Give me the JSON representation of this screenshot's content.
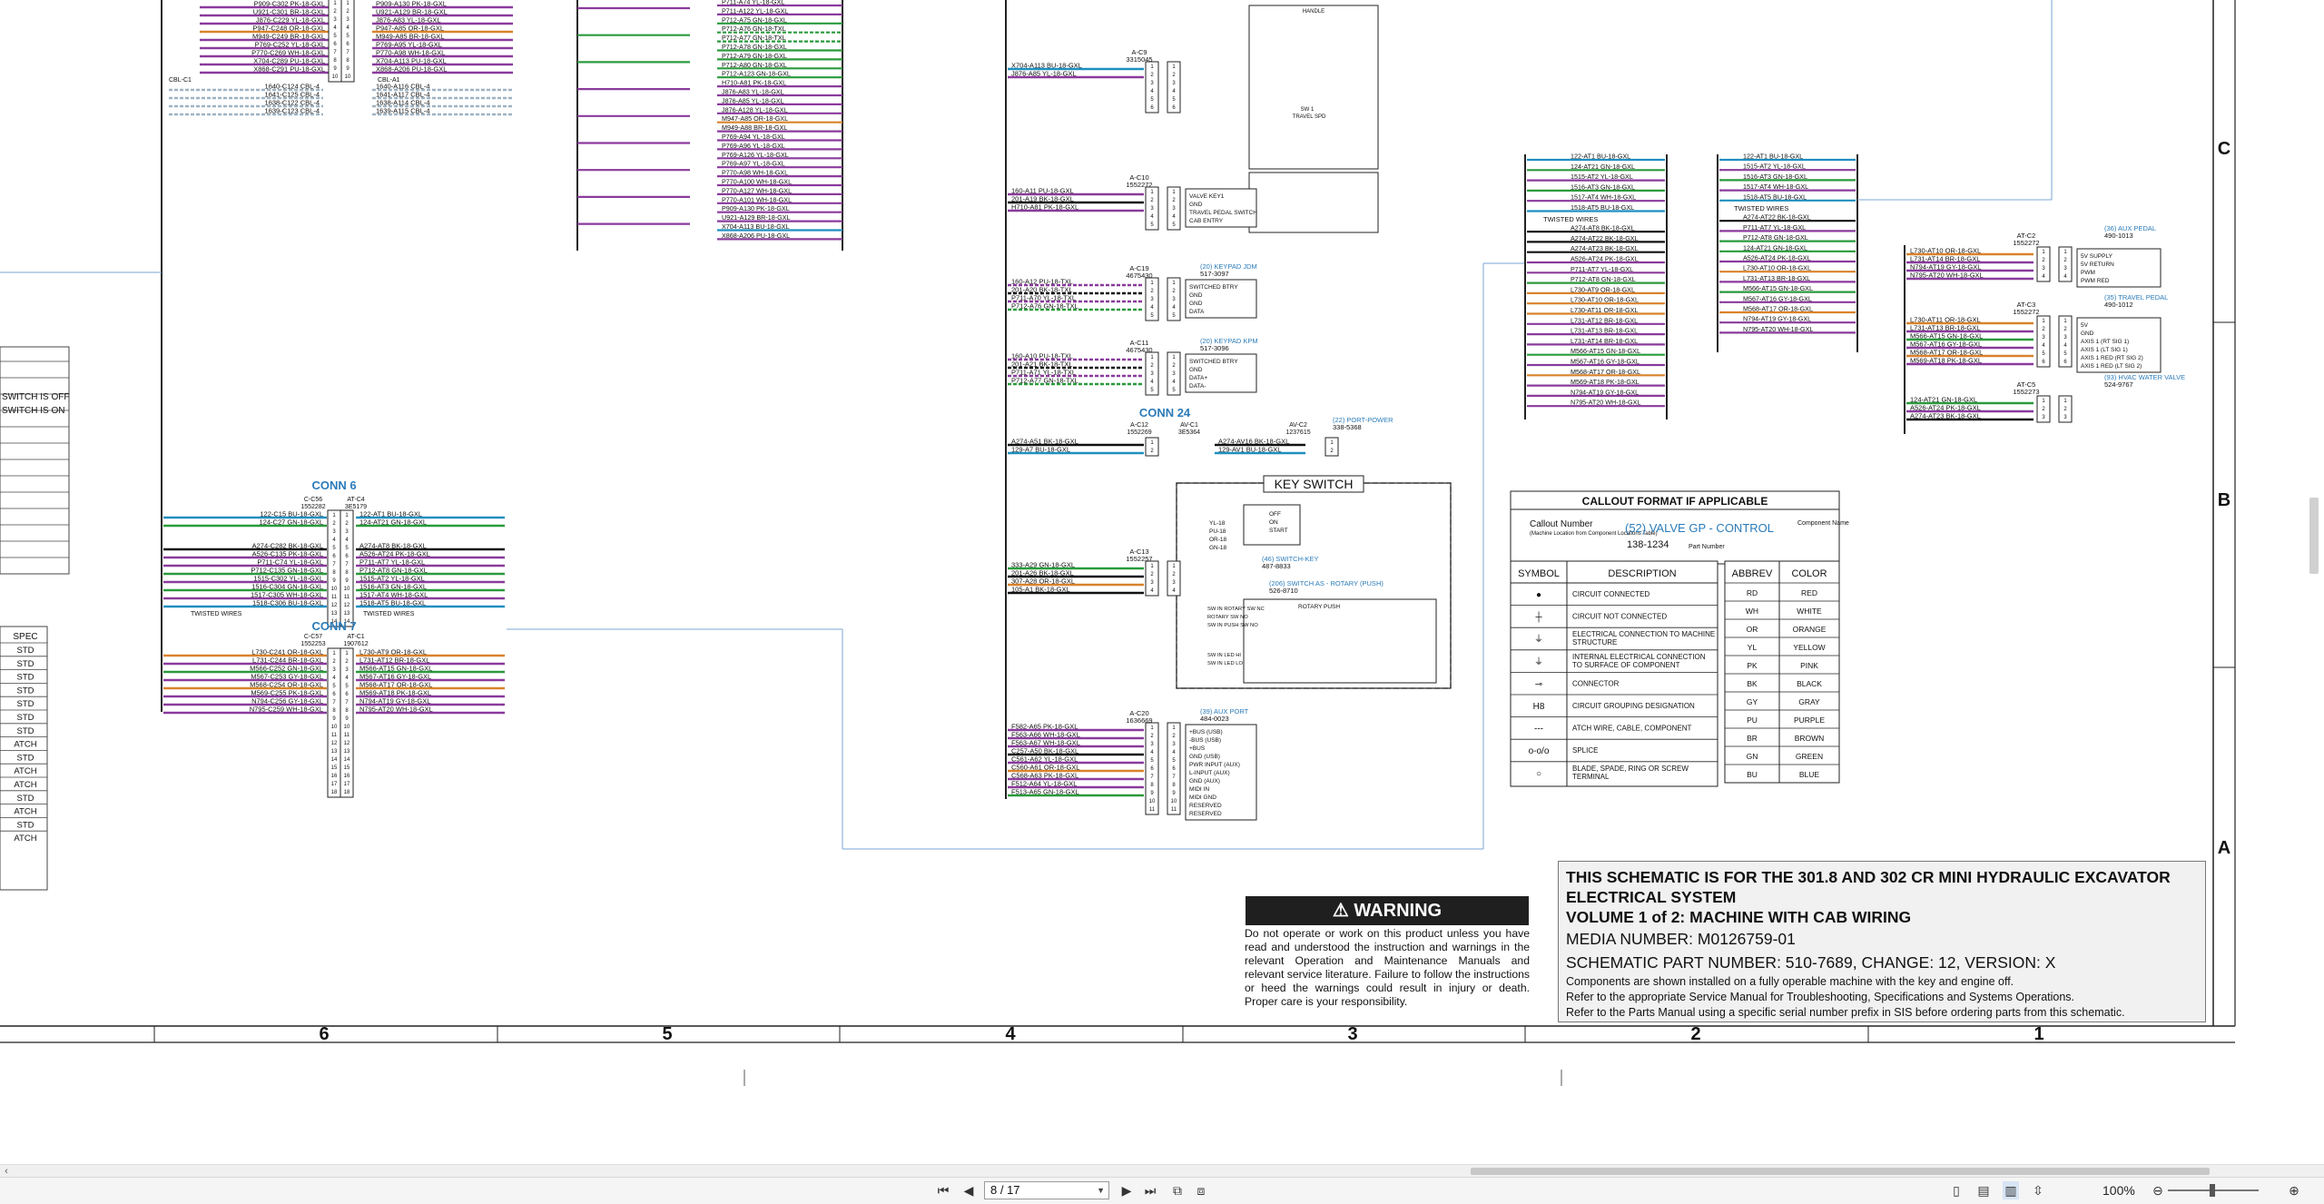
{
  "colors": {
    "purple": "#8a3a9c",
    "cyan": "#1f8fc0",
    "red": "#c8282b",
    "black": "#111111",
    "green": "#2a9a3c",
    "orange": "#d9822b",
    "link": "#2b7bb9",
    "route": "#7aa6d6",
    "gray_wire": "#9fb3c2"
  },
  "viewer": {
    "page_current": "8 / 17",
    "zoom": "100%",
    "icons": [
      "scroll-left-icon",
      "first-page-icon",
      "prev-page-icon",
      "next-page-icon",
      "last-page-icon",
      "page-view-icon",
      "page-tile-icon",
      "single-page-icon",
      "continuous-icon",
      "two-page-icon",
      "fit-icon",
      "zoom-out-icon",
      "zoom-in-icon"
    ]
  },
  "grid": {
    "columns": [
      "6",
      "5",
      "4",
      "3",
      "2",
      "1"
    ],
    "rows": [
      "C",
      "B",
      "A"
    ]
  },
  "side_table": {
    "notes": [
      "SWITCH IS OFF",
      "SWITCH IS ON"
    ],
    "spec_header": "SPEC",
    "spec_values": [
      "STD",
      "STD",
      "STD",
      "STD",
      "STD",
      "STD",
      "STD",
      "ATCH",
      "STD",
      "ATCH",
      "ATCH",
      "STD",
      "ATCH",
      "STD",
      "ATCH"
    ]
  },
  "top_left_wires": {
    "left": [
      "P909-C302 PK-18-GXL",
      "U921-C301 BR-18-GXL",
      "J876-C229 YL-18-GXL",
      "P947-C248 OR-18-GXL",
      "M949-C249 BR-18-GXL",
      "P769-C252 YL-18-GXL",
      "P770-C269 WH-18-GXL",
      "X704-C289 PU-18-GXL",
      "X868-C291 PU-18-GXL"
    ],
    "right": [
      "P909-A130 PK-18-GXL",
      "U921-A129 BR-18-GXL",
      "J876-A83 YL-18-GXL",
      "P947-A85 OR-18-GXL",
      "M949-A85 BR-18-GXL",
      "P769-A95 YL-18-GXL",
      "P770-A98 WH-18-GXL",
      "X704-A113 PU-18-GXL",
      "X868-A206 PU-18-GXL"
    ],
    "cbl_left_label": "CBL-C1",
    "cbl_right_label": "CBL-A1",
    "cbl_left": [
      "1640-C124 CBL-4",
      "1641-C125 CBL-4",
      "1638-C122 CBL-4",
      "1639-C123 CBL-4"
    ],
    "cbl_right": [
      "1640-A116 CBL-4",
      "1641-A117 CBL-4",
      "1638-A114 CBL-4",
      "1639-A115 CBL-4"
    ]
  },
  "conn6": {
    "title": "CONN 6",
    "left_head": "C-C56",
    "left_pn": "1552282",
    "right_head": "AT-C4",
    "right_pn": "3E5179",
    "left": [
      "122-C15 BU-18-GXL",
      "124-C27 GN-18-GXL",
      "A274-C282 BK-18-GXL",
      "A526-C135 PK-18-GXL",
      "P711-C74 YL-18-GXL",
      "P712-C135 GN-18-GXL",
      "1515-C302 YL-18-GXL",
      "1516-C304 GN-18-GXL",
      "1517-C305 WH-18-GXL",
      "1518-C306 BU-18-GXL"
    ],
    "right": [
      "122-AT1 BU-18-GXL",
      "124-AT21 GN-18-GXL",
      "A274-AT8 BK-18-GXL",
      "A526-AT24 PK-18-GXL",
      "P711-AT7 YL-18-GXL",
      "P712-AT8 GN-18-GXL",
      "1515-AT2 YL-18-GXL",
      "1516-AT3 GN-18-GXL",
      "1517-AT4 WH-18-GXL",
      "1518-AT5 BU-18-GXL"
    ],
    "twisted": "TWISTED WIRES"
  },
  "conn7": {
    "title": "CONN 7",
    "left_head": "C-C57",
    "left_pn": "1552253",
    "right_head": "AT-C1",
    "right_pn": "1907612",
    "left": [
      "L730-C241 OR-18-GXL",
      "L731-C244 BR-18-GXL",
      "M566-C252 GN-18-GXL",
      "M567-C253 GY-18-GXL",
      "M568-C254 OR-18-GXL",
      "M569-C255 PK-18-GXL",
      "N794-C256 GY-18-GXL",
      "N795-C259 WH-18-GXL"
    ],
    "right": [
      "L730-AT9 OR-18-GXL",
      "L731-AT12 BR-18-GXL",
      "M566-AT15 GN-18-GXL",
      "M567-AT16 GY-18-GXL",
      "M568-AT17 OR-18-GXL",
      "M569-AT18 PK-18-GXL",
      "N794-AT19 GY-18-GXL",
      "N795-AT20 WH-18-GXL"
    ]
  },
  "mid_wires": [
    "P711-A74 YL-18-GXL",
    "P711-A122 YL-18-GXL",
    "P712-A75 GN-18-GXL",
    "P712-A76 GN-18-TXL",
    "P712-A77 GN-18-TXL",
    "P712-A78 GN-18-GXL",
    "P712-A79 GN-18-GXL",
    "P712-A80 GN-18-GXL",
    "P712-A123 GN-18-GXL",
    "H710-A81 PK-18-GXL",
    "J876-A83 YL-18-GXL",
    "J876-A85 YL-18-GXL",
    "J876-A128 YL-18-GXL",
    "M947-A85 OR-18-GXL",
    "M949-A88 BR-18-GXL",
    "P769-A94 YL-18-GXL",
    "P769-A96 YL-18-GXL",
    "P769-A126 YL-18-GXL",
    "P769-A97 YL-18-GXL",
    "P770-A98 WH-18-GXL",
    "P770-A100 WH-18-GXL",
    "P770-A127 WH-18-GXL",
    "P770-A101 WH-18-GXL",
    "P909-A130 PK-18-GXL",
    "U921-A129 BR-18-GXL",
    "X704-A113 BU-18-GXL",
    "X868-A206 PU-18-GXL"
  ],
  "col4_connectors": {
    "c9": {
      "head": "A-C9",
      "pn": "3315045",
      "wires": [
        "X704-A113 BU-18-GXL",
        "J876-A85 YL-18-GXL"
      ]
    },
    "c10": {
      "head": "A-C10",
      "pn": "1552272",
      "wires": [
        "160-A11 PU-18-GXL",
        "201-A19 BK-18-GXL",
        "H710-A81 PK-18-GXL"
      ],
      "box": [
        "VALVE KEY1",
        "GND",
        "TRAVEL PEDAL SWITCH",
        "CAB ENTRY"
      ]
    },
    "c19": {
      "head": "A-C19",
      "pn": "4675430",
      "link": "(20) KEYPAD JDM",
      "link_pn": "517-3097",
      "wires": [
        "160-A12 PU-18-TXL",
        "201-A20 BK-18-TXL",
        "P711-A70 YL-18-TXL",
        "P712-A76 GN-18-TXL"
      ],
      "box": [
        "SWITCHED BTRY",
        "GND",
        "GND",
        "DATA"
      ]
    },
    "c11": {
      "head": "A-C11",
      "pn": "4675430",
      "link": "(20) KEYPAD KPM",
      "link_pn": "517-3096",
      "wires": [
        "160-A10 PU-18-TXL",
        "201-A21 BK-18-TXL",
        "P711-A71 YL-18-TXL",
        "P712-A77 GN-18-TXL"
      ],
      "box": [
        "SWITCHED BTRY",
        "GND",
        "DATA+",
        "DATA-"
      ]
    },
    "conn24": {
      "title": "CONN 24",
      "c12": "A-C12",
      "c12_pn": "1552269",
      "c1": "AV-C1",
      "c1_pn": "3E5364",
      "c2": "AV-C2",
      "c2_pn": "1237615",
      "left": [
        "A274-A51 BK-18-GXL",
        "129-A7 BU-18-GXL"
      ],
      "right": [
        "A274-AV16 BK-18-GXL",
        "129-AV1 BU-18-GXL"
      ],
      "link": "(22) PORT-POWER",
      "link_pn": "338-5368"
    },
    "c13": {
      "head": "A-C13",
      "pn": "1552257",
      "wires": [
        "333-A29 GN-18-GXL",
        "201-A26 BK-18-GXL",
        "307-A28 OR-18-GXL",
        "105-A1 BK-18-GXL"
      ]
    },
    "c20": {
      "head": "A-C20",
      "pn": "1636669",
      "link": "(39) AUX PORT",
      "link_pn": "484-0023",
      "wires": [
        "F582-A65 PK-18-GXL",
        "F563-A66 WH-18-GXL",
        "F563-A67 WH-18-GXL",
        "C257-A50 BK-18-GXL",
        "C561-A62 YL-18-GXL",
        "C560-A61 OR-18-GXL",
        "C568-A63 PK-18-GXL",
        "F512-A64 YL-18-GXL",
        "F513-A65 GN-18-GXL"
      ],
      "box": [
        "+BUS (USB)",
        "-BUS (USB)",
        "+BUS",
        "GND (USB)",
        "PWR INPUT (AUX)",
        "L-INPUT (AUX)",
        "GND (AUX)",
        "MIDI IN",
        "MIDI GND",
        "RESERVED",
        "RESERVED"
      ]
    }
  },
  "keyswitch": {
    "title": "KEY SWITCH",
    "pins": [
      "YL-18",
      "PU-18",
      "OR-18",
      "GN-18"
    ],
    "positions": [
      "OFF",
      "ON",
      "START"
    ],
    "link1": "(46) SWITCH-KEY",
    "link1_pn": "487-8833",
    "link2": "(206) SWITCH AS - ROTARY (PUSH)",
    "link2_pn": "526-8710",
    "box": [
      "ROTARY",
      "PUSH"
    ],
    "inner_labels": [
      "SW IN ROTARY SW NC",
      "ROTARY SW NO",
      "SW IN PUSH SW NO",
      "SW IN LED HI",
      "SW IN LED LO"
    ]
  },
  "handle": {
    "label": "HANDLE",
    "travel": "TRAVEL SPD",
    "switch": "SW 1"
  },
  "callout": {
    "title": "CALLOUT FORMAT IF APPLICABLE",
    "callout_number": "Callout Number",
    "callout_number_sub": "(Machine Location from Component Locations Table)",
    "example": "(52) VALVE GP - CONTROL",
    "part": "138-1234",
    "component_name": "Component Name",
    "part_number": "Part Number"
  },
  "legend": {
    "symbol_header": "SYMBOL",
    "desc_header": "DESCRIPTION",
    "rows": [
      "CIRCUIT CONNECTED",
      "CIRCUIT NOT CONNECTED",
      "ELECTRICAL CONNECTION TO MACHINE STRUCTURE",
      "INTERNAL ELECTRICAL CONNECTION TO SURFACE OF COMPONENT",
      "CONNECTOR",
      "CIRCUIT GROUPING DESIGNATION",
      "ATCH WIRE, CABLE, COMPONENT",
      "SPLICE",
      "BLADE, SPADE, RING OR SCREW TERMINAL"
    ],
    "symbols": [
      "●",
      "┼",
      "⏚",
      "⏚",
      "⊸",
      "H8",
      "---",
      "o-o/o",
      "○"
    ]
  },
  "colors_table": {
    "abbrev_header": "ABBREV",
    "color_header": "COLOR",
    "rows": [
      [
        "RD",
        "RED"
      ],
      [
        "WH",
        "WHITE"
      ],
      [
        "OR",
        "ORANGE"
      ],
      [
        "YL",
        "YELLOW"
      ],
      [
        "PK",
        "PINK"
      ],
      [
        "BK",
        "BLACK"
      ],
      [
        "GY",
        "GRAY"
      ],
      [
        "PU",
        "PURPLE"
      ],
      [
        "BR",
        "BROWN"
      ],
      [
        "GN",
        "GREEN"
      ],
      [
        "BU",
        "BLUE"
      ]
    ]
  },
  "right_bundle_left": [
    "122-AT1 BU-18-GXL",
    "124-AT21 GN-18-GXL",
    "1515-AT2 YL-18-GXL",
    "1516-AT3 GN-18-GXL",
    "1517-AT4 WH-18-GXL",
    "1518-AT5 BU-18-GXL",
    "TWISTED WIRES",
    "A274-AT8 BK-18-GXL",
    "A274-AT22 BK-18-GXL",
    "A274-AT23 BK-18-GXL",
    "A526-AT24 PK-18-GXL",
    "P711-AT7 YL-18-GXL",
    "P712-AT8 GN-18-GXL",
    "L730-AT9 OR-18-GXL",
    "L730-AT10 OR-18-GXL",
    "L730-AT11 OR-18-GXL",
    "L731-AT12 BR-18-GXL",
    "L731-AT13 BR-18-GXL",
    "L731-AT14 BR-18-GXL",
    "M566-AT15 GN-18-GXL",
    "M567-AT16 GY-18-GXL",
    "M568-AT17 OR-18-GXL",
    "M569-AT18 PK-18-GXL",
    "N794-AT19 GY-18-GXL",
    "N795-AT20 WH-18-GXL"
  ],
  "right_bundle_mid": [
    "122-AT1 BU-18-GXL",
    "1515-AT2 YL-18-GXL",
    "1516-AT3 GN-18-GXL",
    "1517-AT4 WH-18-GXL",
    "1518-AT5 BU-18-GXL",
    "TWISTED WIRES",
    "A274-AT22 BK-18-GXL",
    "P711-AT7 YL-18-GXL",
    "P712-AT8 GN-18-GXL",
    "124-AT21 GN-18-GXL",
    "A526-AT24 PK-18-GXL",
    "L730-AT10 OR-18-GXL",
    "L731-AT13 BR-18-GXL",
    "M566-AT15 GN-18-GXL",
    "M567-AT16 GY-18-GXL",
    "M568-AT17 OR-18-GXL",
    "N794-AT19 GY-18-GXL",
    "N795-AT20 WH-18-GXL"
  ],
  "far_right": {
    "c2": {
      "head": "AT-C2",
      "pn": "1552272",
      "link": "(36) AUX PEDAL",
      "link_pn": "490-1013",
      "wires": [
        "L730-AT10 OR-18-GXL",
        "L731-AT14 BR-18-GXL",
        "N794-AT19 GY-18-GXL",
        "N795-AT20 WH-18-GXL"
      ],
      "box": [
        "5V SUPPLY",
        "5V RETURN",
        "PWM",
        "PWM RED"
      ]
    },
    "c3": {
      "head": "AT-C3",
      "pn": "1552272",
      "link": "(35) TRAVEL PEDAL",
      "link_pn": "490-1012",
      "wires": [
        "L730-AT11 OR-18-GXL",
        "L731-AT13 BR-18-GXL",
        "M566-AT15 GN-18-GXL",
        "M567-AT16 GY-18-GXL",
        "M568-AT17 OR-18-GXL",
        "M569-AT18 PK-18-GXL"
      ],
      "box": [
        "5V",
        "GND",
        "AXIS 1 (RT SIG 1)",
        "AXIS 1 (LT SIG 1)",
        "AXIS 1 RED (RT SIG 2)",
        "AXIS 1 RED (LT SIG 2)"
      ]
    },
    "c5": {
      "head": "AT-C5",
      "pn": "1552273",
      "link": "(93) HVAC WATER VALVE",
      "link_pn": "524-9767",
      "wires": [
        "124-AT21 GN-18-GXL",
        "A526-AT24 PK-18-GXL",
        "A274-AT23 BK-18-GXL"
      ]
    }
  },
  "warning": {
    "title": "WARNING",
    "text": "Do not operate or work on this product unless you have read and understood the instruction and warnings in the relevant Operation and Maintenance Manuals and relevant service literature. Failure to follow the instructions or heed the warnings could result in injury or death. Proper care is your responsibility."
  },
  "title_block": {
    "line1": "THIS SCHEMATIC IS FOR THE 301.8 AND 302 CR MINI HYDRAULIC EXCAVATOR",
    "line2": "ELECTRICAL SYSTEM",
    "line3": "VOLUME 1 of 2: MACHINE WITH CAB WIRING",
    "media": "MEDIA NUMBER: M0126759-01",
    "part": "SCHEMATIC PART NUMBER: 510-7689, CHANGE: 12, VERSION: X",
    "note1": "Components are shown installed on a fully operable machine with the key and engine off.",
    "note2": "Refer to the appropriate Service Manual for Troubleshooting, Specifications and Systems Operations.",
    "note3": "Refer to the Parts Manual using a specific serial number prefix in SIS before ordering parts from this schematic."
  }
}
